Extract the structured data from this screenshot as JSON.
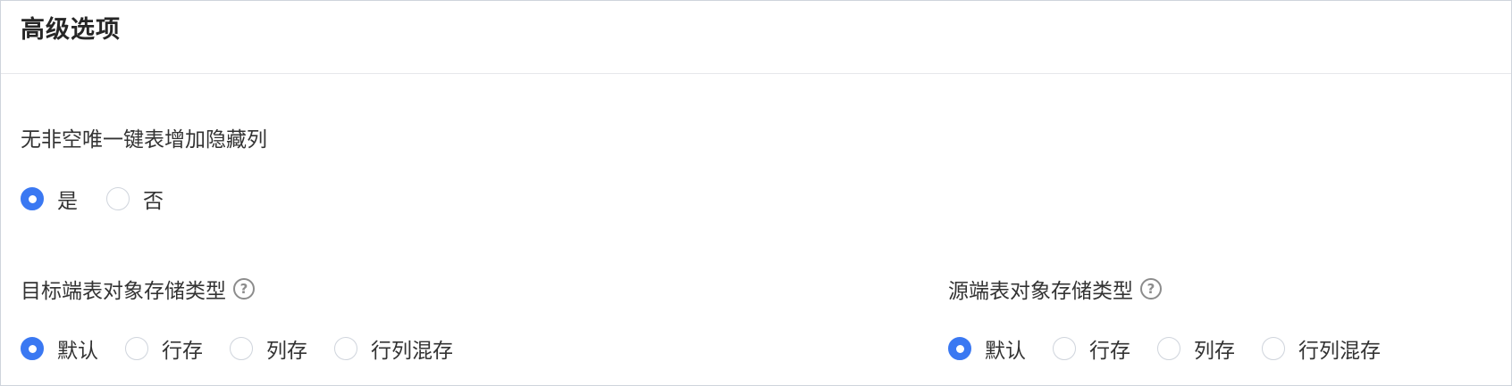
{
  "section": {
    "title": "高级选项"
  },
  "hidden_column": {
    "label": "无非空唯一键表增加隐藏列",
    "options": [
      "是",
      "否"
    ],
    "selected": "是"
  },
  "target_storage": {
    "label": "目标端表对象存储类型",
    "options": [
      "默认",
      "行存",
      "列存",
      "行列混存"
    ],
    "selected": "默认"
  },
  "source_storage": {
    "label": "源端表对象存储类型",
    "options": [
      "默认",
      "行存",
      "列存",
      "行列混存"
    ],
    "selected": "默认"
  },
  "colors": {
    "accent": "#3a78f2"
  }
}
